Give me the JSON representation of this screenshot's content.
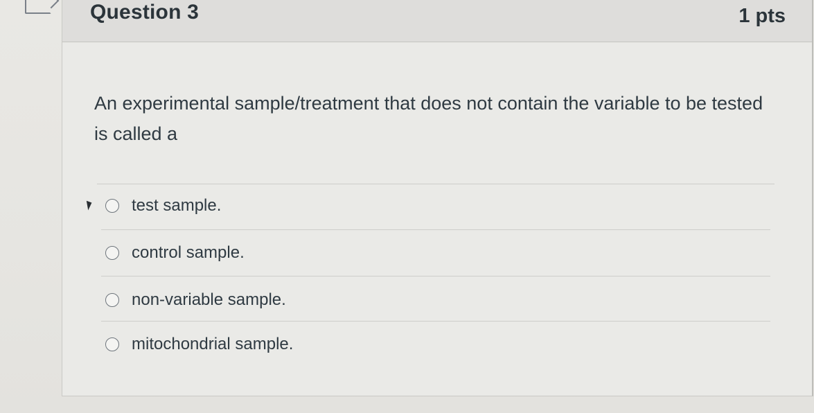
{
  "question": {
    "title": "Question 3",
    "points": "1 pts",
    "text": "An experimental sample/treatment that does not contain the variable to be tested is called a"
  },
  "answers": [
    {
      "label": "test sample."
    },
    {
      "label": "control sample."
    },
    {
      "label": "non-variable sample."
    },
    {
      "label": "mitochondrial sample."
    }
  ],
  "icons": {
    "flag": "flag-question-icon",
    "radio": "radio-button-icon",
    "cursor": "mouse-pointer-icon"
  },
  "colors": {
    "header_bg": "#dedddb",
    "card_bg": "#eaeae7",
    "text": "#2f3a42"
  }
}
